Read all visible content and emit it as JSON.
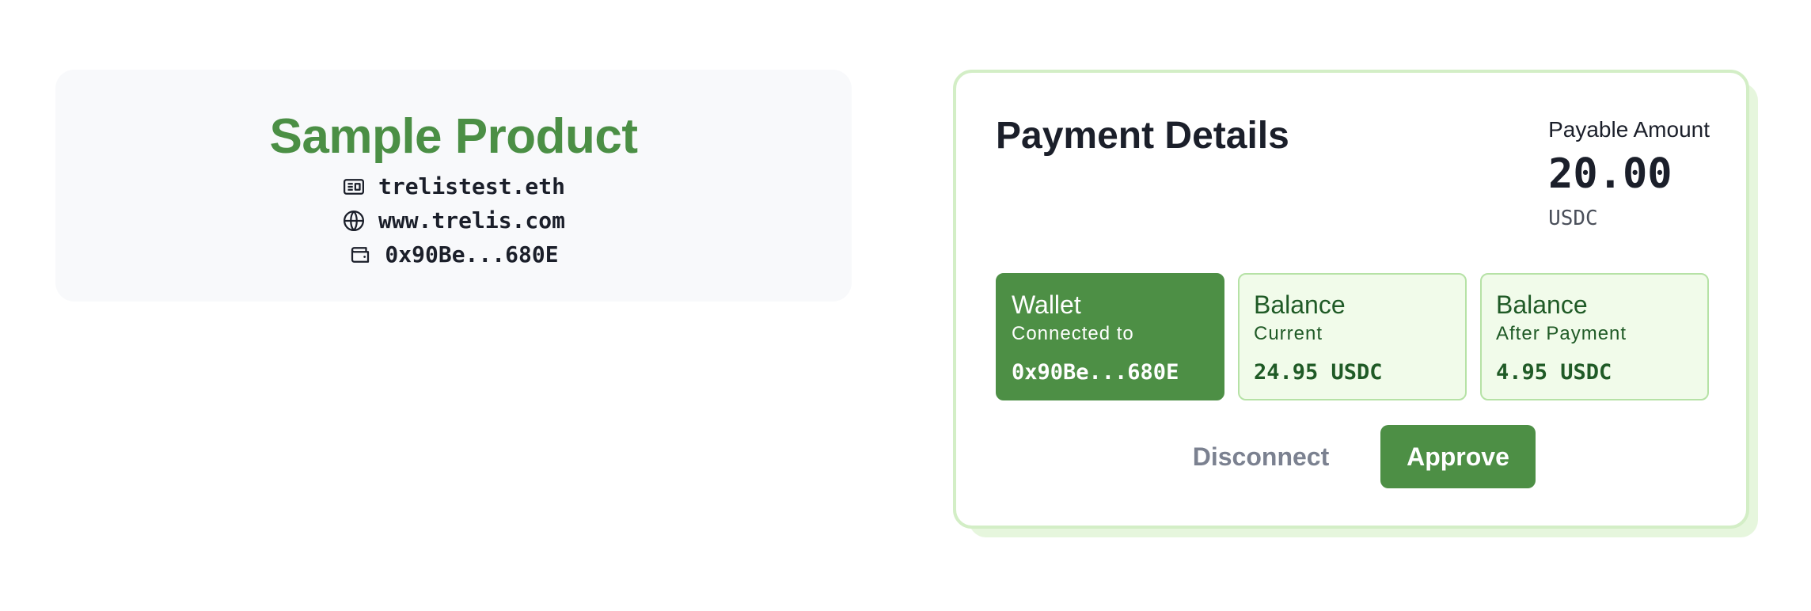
{
  "product": {
    "title": "Sample Product",
    "meta": [
      {
        "icon": "id-card-icon",
        "text": "trelistest.eth"
      },
      {
        "icon": "globe-icon",
        "text": "www.trelis.com"
      },
      {
        "icon": "wallet-icon",
        "text": "0x90Be...680E"
      }
    ]
  },
  "payment": {
    "title": "Payment Details",
    "payable_label": "Payable Amount",
    "amount": "20.00",
    "currency": "USDC",
    "tiles": [
      {
        "title": "Wallet",
        "subtitle": "Connected to",
        "value": "0x90Be...680E",
        "active": true
      },
      {
        "title": "Balance",
        "subtitle": "Current",
        "value": "24.95 USDC",
        "active": false
      },
      {
        "title": "Balance",
        "subtitle": "After Payment",
        "value": "4.95 USDC",
        "active": false
      }
    ],
    "disconnect_label": "Disconnect",
    "approve_label": "Approve"
  },
  "colors": {
    "brand_green": "#4d8f45",
    "tile_bg": "#f1fbea",
    "tile_border": "#b6e2a6",
    "card_border": "#d3eec6",
    "muted_text": "#7b8190"
  }
}
